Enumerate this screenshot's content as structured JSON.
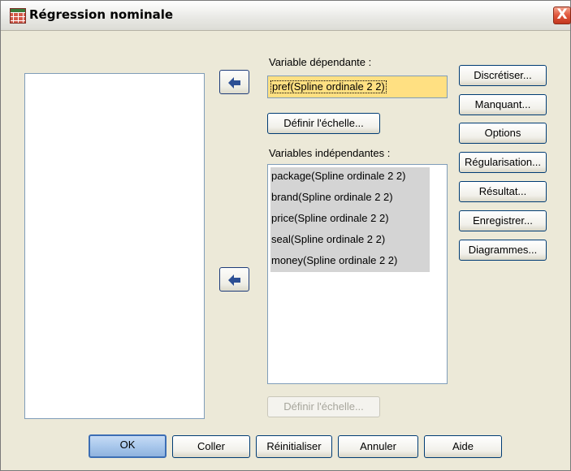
{
  "window": {
    "title": "Régression nominale",
    "close_label": "X"
  },
  "source_list": {
    "items": []
  },
  "dependent": {
    "label": "Variable dépendante :",
    "value": "pref(Spline ordinale 2 2)",
    "scale_button": "Définir l'échelle..."
  },
  "independent": {
    "label": "Variables indépendantes :",
    "items": [
      "package(Spline ordinale 2 2)",
      "brand(Spline ordinale 2 2)",
      "price(Spline ordinale 2 2)",
      "seal(Spline ordinale 2 2)",
      "money(Spline ordinale 2 2)"
    ],
    "scale_button": "Définir l'échelle..."
  },
  "side_buttons": {
    "discretize": "Discrétiser...",
    "missing": "Manquant...",
    "options": "Options",
    "regularization": "Régularisation...",
    "output": "Résultat...",
    "save": "Enregistrer...",
    "plots": "Diagrammes..."
  },
  "footer_buttons": {
    "ok": "OK",
    "paste": "Coller",
    "reset": "Réinitialiser",
    "cancel": "Annuler",
    "help": "Aide"
  },
  "icons": {
    "move_arrow": "move-left-arrow-icon",
    "app": "table-icon"
  },
  "colors": {
    "dependent_field_bg": "#ffe082",
    "selection_bg": "#d4d4d4"
  }
}
